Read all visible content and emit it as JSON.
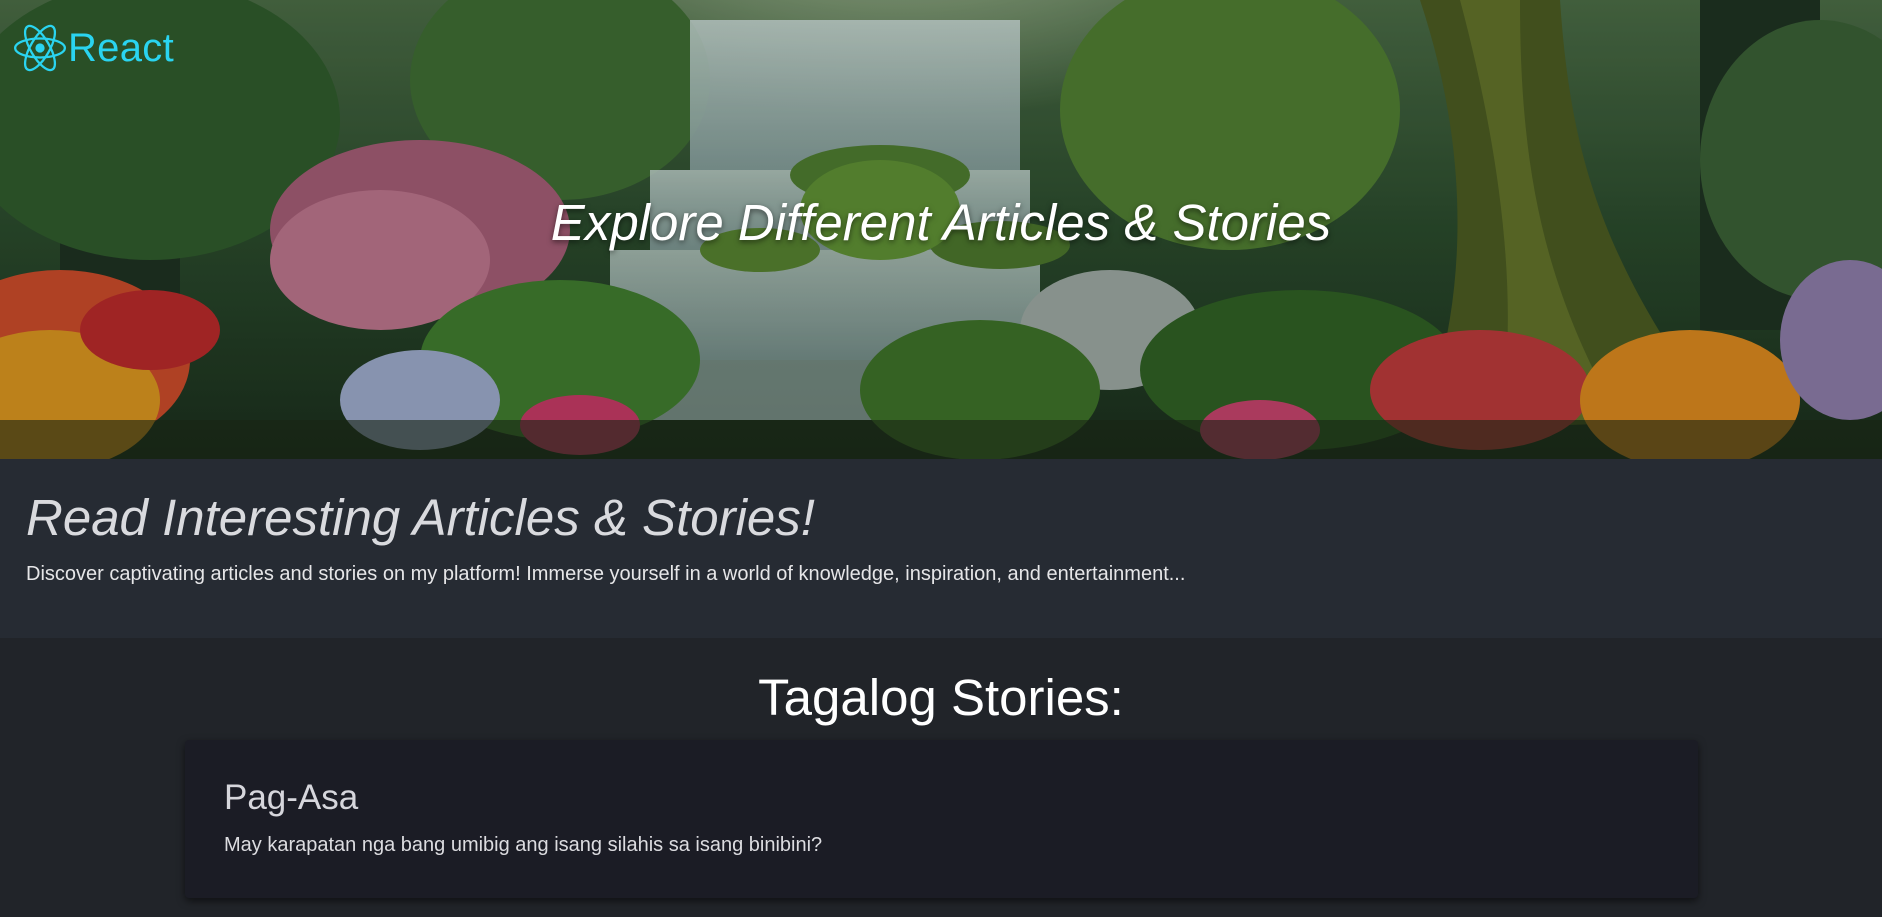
{
  "header": {
    "logo_text": "React",
    "logo_icon": "react-atom-icon",
    "brand_color": "#2ad4f0"
  },
  "hero": {
    "title": "Explore Different Articles & Stories",
    "background": "forest-waterfall-illustration"
  },
  "intro": {
    "title": "Read Interesting Articles & Stories!",
    "text": "Discover captivating articles and stories on my platform! Immerse yourself in a world of knowledge, inspiration, and entertainment..."
  },
  "stories": {
    "section_title": "Tagalog Stories:",
    "items": [
      {
        "title": "Pag-Asa",
        "description": "May karapatan nga bang umibig ang isang silahis sa isang binibini?"
      }
    ]
  },
  "colors": {
    "page_bg": "#212429",
    "intro_bg": "#262b33",
    "card_bg": "#1b1c25"
  }
}
